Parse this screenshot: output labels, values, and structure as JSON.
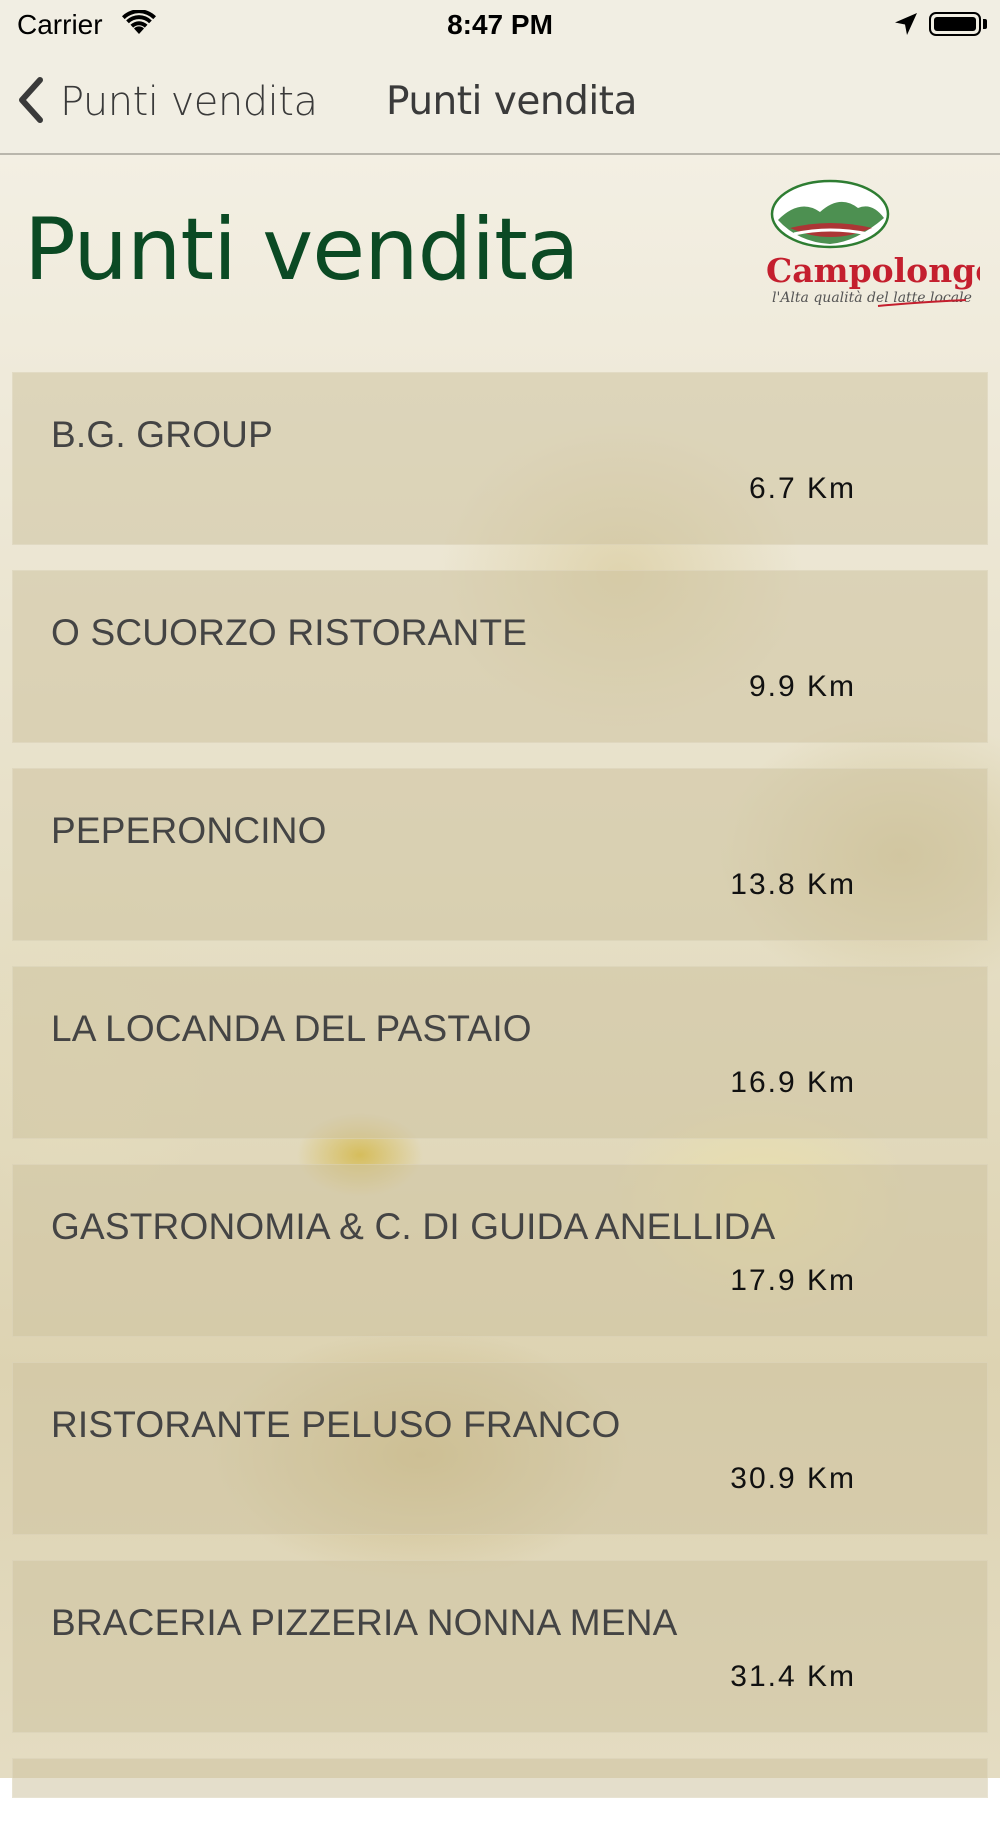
{
  "status_bar": {
    "carrier": "Carrier",
    "time": "8:47 PM",
    "icons": [
      "wifi-icon",
      "location-arrow-icon",
      "battery-icon"
    ]
  },
  "nav": {
    "back_label": "Punti vendita",
    "title": "Punti vendita"
  },
  "header": {
    "title": "Punti vendita",
    "logo": {
      "brand": "Campolongo",
      "tagline": "l'Alta qualità del latte locale"
    }
  },
  "stores": [
    {
      "name": "B.G. GROUP",
      "distance": "6.7 Km"
    },
    {
      "name": "O SCUORZO RISTORANTE",
      "distance": "9.9 Km"
    },
    {
      "name": "PEPERONCINO",
      "distance": "13.8 Km"
    },
    {
      "name": "LA LOCANDA DEL PASTAIO",
      "distance": "16.9 Km"
    },
    {
      "name": "GASTRONOMIA & C. DI GUIDA ANELLIDA",
      "distance": "17.9 Km"
    },
    {
      "name": "RISTORANTE PELUSO FRANCO",
      "distance": "30.9 Km"
    },
    {
      "name": "BRACERIA PIZZERIA NONNA MENA",
      "distance": "31.4 Km"
    }
  ],
  "colors": {
    "title_green": "#0b4a24",
    "logo_red": "#c41f2e",
    "logo_green": "#2e7d32",
    "bar_bg": "#f1eee3"
  }
}
